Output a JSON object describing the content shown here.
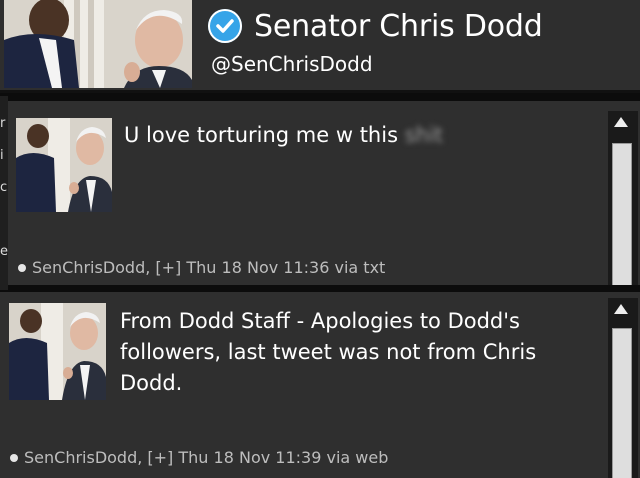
{
  "profile": {
    "display_name": "Senator Chris Dodd",
    "handle": "@SenChrisDodd",
    "verified_icon": "verified-check-icon",
    "accent_color": "#36a4e8"
  },
  "tweets": [
    {
      "text_visible": "U love torturing me w this",
      "text_blurred": "shit",
      "author": "SenChrisDodd",
      "expand": "[+]",
      "timestamp": "Thu 18 Nov 11:36",
      "via": "via txt"
    },
    {
      "text_visible": "From Dodd Staff - Apologies to Dodd's followers, last tweet was not from Chris Dodd.",
      "author": "SenChrisDodd",
      "expand": "[+]",
      "timestamp": "Thu 18 Nov 11:39",
      "via": "via web"
    }
  ],
  "left_strip_glyphs": [
    "r",
    "i",
    "c",
    "e"
  ]
}
